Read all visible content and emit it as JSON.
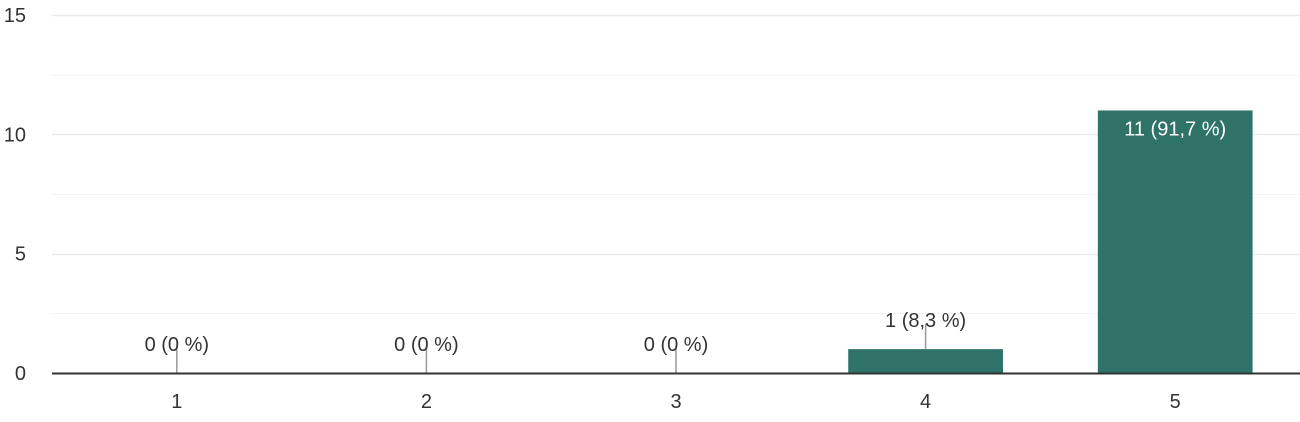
{
  "chart_data": {
    "type": "bar",
    "categories": [
      "1",
      "2",
      "3",
      "4",
      "5"
    ],
    "values": [
      0,
      0,
      0,
      1,
      11
    ],
    "data_labels": [
      "0 (0 %)",
      "0 (0 %)",
      "0 (0 %)",
      "1 (8,3 %)",
      "11 (91,7 %)"
    ],
    "yticks": [
      0,
      5,
      10,
      15
    ],
    "ylim": [
      0,
      15
    ],
    "minor_gridlines": true,
    "title": "",
    "xlabel": "",
    "ylabel": "",
    "bar_color": "#2e7268",
    "gridline_color": "#ebebeb",
    "axis_color": "#333333",
    "label_color": "#333333",
    "inside_label_color": "#ffffff"
  }
}
